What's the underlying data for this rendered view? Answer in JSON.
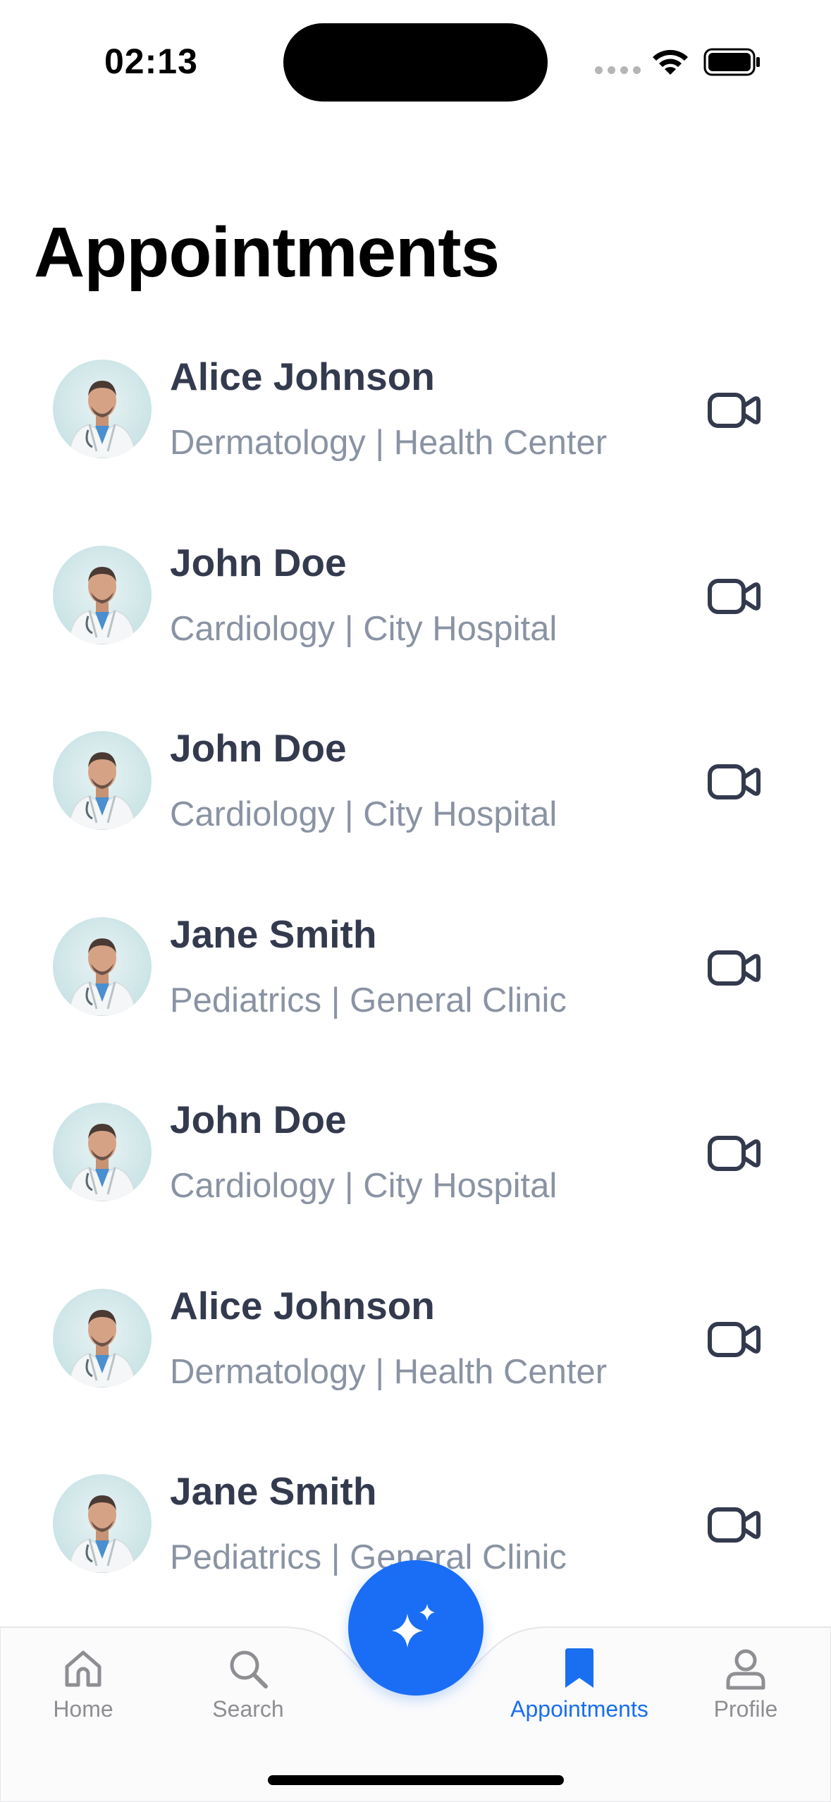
{
  "status_bar": {
    "time": "02:13"
  },
  "page": {
    "title": "Appointments"
  },
  "appointments": [
    {
      "name": "Alice Johnson",
      "subtitle": "Dermatology | Health Center"
    },
    {
      "name": "John Doe",
      "subtitle": "Cardiology | City Hospital"
    },
    {
      "name": "John Doe",
      "subtitle": "Cardiology | City Hospital"
    },
    {
      "name": "Jane Smith",
      "subtitle": "Pediatrics | General Clinic"
    },
    {
      "name": "John Doe",
      "subtitle": "Cardiology | City Hospital"
    },
    {
      "name": "Alice Johnson",
      "subtitle": "Dermatology | Health Center"
    },
    {
      "name": "Jane Smith",
      "subtitle": "Pediatrics | General Clinic"
    }
  ],
  "row_action_icon": "video-call-icon",
  "tab_bar": {
    "tabs": [
      {
        "label": "Home",
        "icon": "home-icon",
        "active": false
      },
      {
        "label": "Search",
        "icon": "search-icon",
        "active": false
      },
      {
        "label": "Appointments",
        "icon": "bookmark-icon",
        "active": true
      },
      {
        "label": "Profile",
        "icon": "profile-icon",
        "active": false
      }
    ],
    "center_action_icon": "sparkles-icon"
  },
  "colors": {
    "accent": "#1a6ef5",
    "name_text": "#343a4e",
    "subtitle_text": "#8a93a3",
    "inactive_tab": "#8e8e93"
  }
}
